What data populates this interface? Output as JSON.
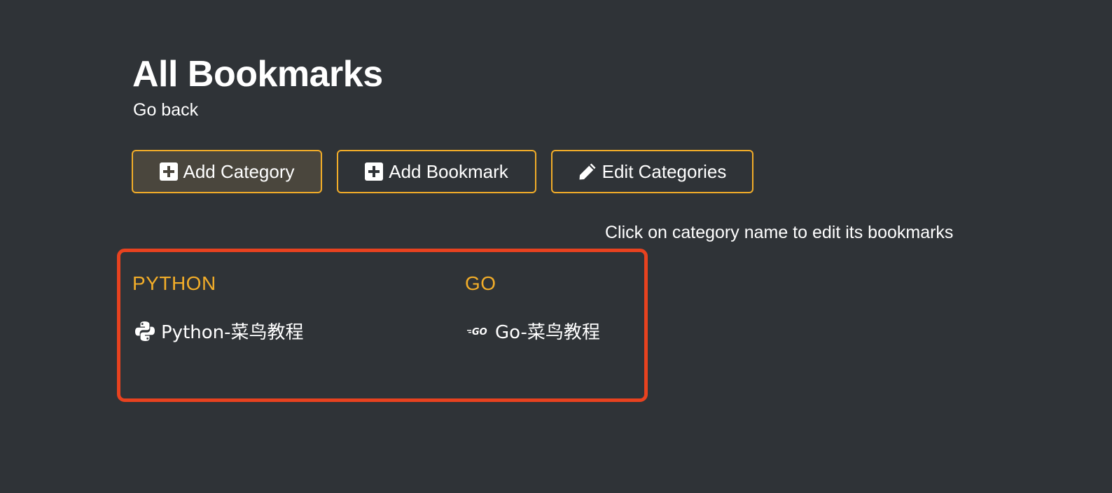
{
  "header": {
    "title": "All Bookmarks",
    "go_back": "Go back"
  },
  "toolbar": {
    "add_category": {
      "label": "Add Category",
      "icon": "plus-square-icon"
    },
    "add_bookmark": {
      "label": "Add Bookmark",
      "icon": "plus-square-icon"
    },
    "edit_categories": {
      "label": "Edit Categories",
      "icon": "pencil-icon"
    }
  },
  "hint": "Click on category name to edit its bookmarks",
  "categories": [
    {
      "name": "PYTHON",
      "bookmarks": [
        {
          "label": "Python-菜鸟教程",
          "icon": "python-icon"
        }
      ]
    },
    {
      "name": "GO",
      "bookmarks": [
        {
          "label": "Go-菜鸟教程",
          "icon": "golang-icon"
        }
      ]
    }
  ],
  "colors": {
    "background": "#2f3337",
    "accent": "#f2ad29",
    "highlight_border": "#e8421f",
    "text": "#ffffff"
  }
}
